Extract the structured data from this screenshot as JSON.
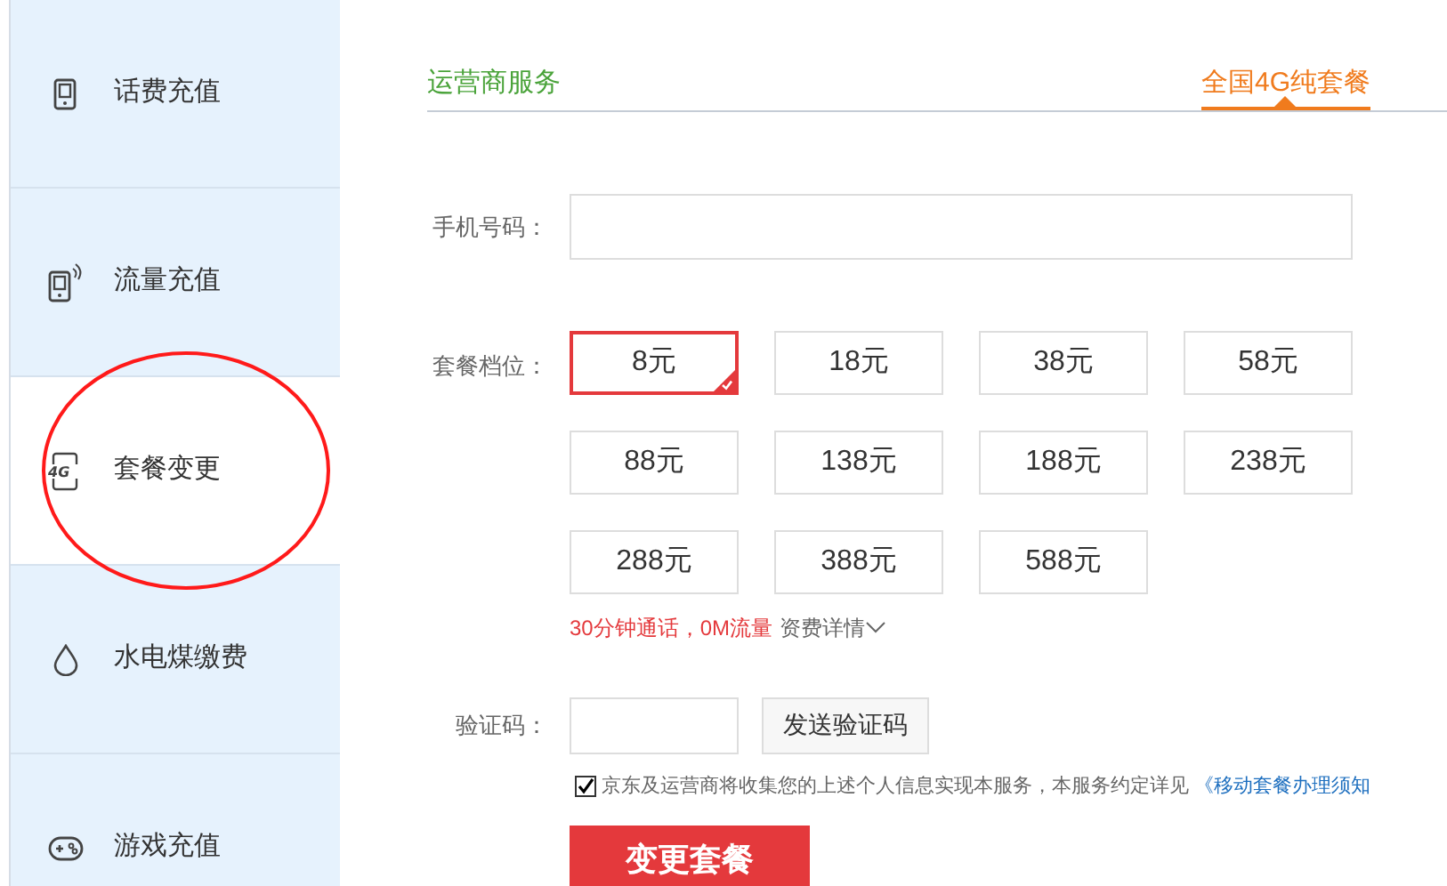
{
  "sidebar": {
    "items": [
      {
        "label": "话费充值",
        "kind": "phone",
        "selected": false
      },
      {
        "label": "流量充值",
        "kind": "signal",
        "selected": false
      },
      {
        "label": "套餐变更",
        "kind": "network",
        "icon_text": "4G",
        "selected": true
      },
      {
        "label": "水电煤缴费",
        "kind": "water",
        "selected": false
      },
      {
        "label": "游戏充值",
        "kind": "game",
        "selected": false
      }
    ]
  },
  "tabs": [
    {
      "label": "运营商服务",
      "selected": false
    },
    {
      "label": "全国4G纯套餐",
      "selected": true
    }
  ],
  "form": {
    "phone_label": "手机号码：",
    "plan_label": "套餐档位：",
    "plans": [
      {
        "label": "8元",
        "selected": true
      },
      {
        "label": "18元",
        "selected": false
      },
      {
        "label": "38元",
        "selected": false
      },
      {
        "label": "58元",
        "selected": false
      },
      {
        "label": "88元",
        "selected": false
      },
      {
        "label": "138元",
        "selected": false
      },
      {
        "label": "188元",
        "selected": false
      },
      {
        "label": "238元",
        "selected": false
      },
      {
        "label": "288元",
        "selected": false
      },
      {
        "label": "388元",
        "selected": false
      },
      {
        "label": "588元",
        "selected": false
      }
    ],
    "plan_summary": "30分钟通话，0M流量",
    "details_link": "资费详情",
    "code_label": "验证码：",
    "send_code_button": "发送验证码",
    "consent": {
      "checked": true,
      "text": "京东及运营商将收集您的上述个人信息实现本服务，本服务约定详见",
      "link": "《移动套餐办理须知"
    },
    "submit_button": "变更套餐"
  }
}
